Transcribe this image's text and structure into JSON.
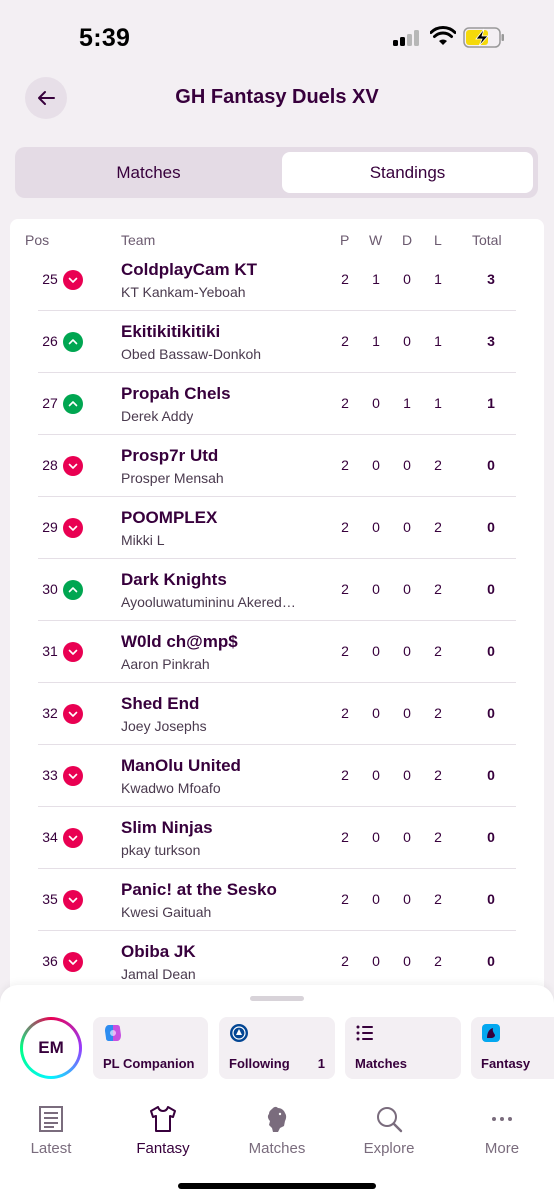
{
  "status": {
    "time": "5:39"
  },
  "header": {
    "title": "GH Fantasy Duels XV"
  },
  "tabs": {
    "matches": "Matches",
    "standings": "Standings"
  },
  "table": {
    "headers": {
      "pos": "Pos",
      "team": "Team",
      "p": "P",
      "w": "W",
      "d": "D",
      "l": "L",
      "total": "Total"
    },
    "rows": [
      {
        "pos": "25",
        "move": "down",
        "team": "ColdplayCam KT",
        "manager": "KT Kankam-Yeboah",
        "p": "2",
        "w": "1",
        "d": "0",
        "l": "1",
        "total": "3"
      },
      {
        "pos": "26",
        "move": "up",
        "team": "Ekitikitikitiki",
        "manager": "Obed Bassaw-Donkoh",
        "p": "2",
        "w": "1",
        "d": "0",
        "l": "1",
        "total": "3"
      },
      {
        "pos": "27",
        "move": "up",
        "team": "Propah Chels",
        "manager": "Derek Addy",
        "p": "2",
        "w": "0",
        "d": "1",
        "l": "1",
        "total": "1"
      },
      {
        "pos": "28",
        "move": "down",
        "team": "Prosp7r Utd",
        "manager": "Prosper Mensah",
        "p": "2",
        "w": "0",
        "d": "0",
        "l": "2",
        "total": "0"
      },
      {
        "pos": "29",
        "move": "down",
        "team": "POOMPLEX",
        "manager": "Mikki L",
        "p": "2",
        "w": "0",
        "d": "0",
        "l": "2",
        "total": "0"
      },
      {
        "pos": "30",
        "move": "up",
        "team": "Dark Knights",
        "manager": "Ayooluwatumininu Akered…",
        "p": "2",
        "w": "0",
        "d": "0",
        "l": "2",
        "total": "0"
      },
      {
        "pos": "31",
        "move": "down",
        "team": "W0ld ch@mp$",
        "manager": "Aaron Pinkrah",
        "p": "2",
        "w": "0",
        "d": "0",
        "l": "2",
        "total": "0"
      },
      {
        "pos": "32",
        "move": "down",
        "team": "Shed End",
        "manager": "Joey Josephs",
        "p": "2",
        "w": "0",
        "d": "0",
        "l": "2",
        "total": "0"
      },
      {
        "pos": "33",
        "move": "down",
        "team": "ManOlu United",
        "manager": "Kwadwo Mfoafo",
        "p": "2",
        "w": "0",
        "d": "0",
        "l": "2",
        "total": "0"
      },
      {
        "pos": "34",
        "move": "down",
        "team": "Slim Ninjas",
        "manager": "pkay turkson",
        "p": "2",
        "w": "0",
        "d": "0",
        "l": "2",
        "total": "0"
      },
      {
        "pos": "35",
        "move": "down",
        "team": "Panic! at the Sesko",
        "manager": "Kwesi Gaituah",
        "p": "2",
        "w": "0",
        "d": "0",
        "l": "2",
        "total": "0"
      },
      {
        "pos": "36",
        "move": "down",
        "team": "Obiba JK",
        "manager": "Jamal Dean",
        "p": "2",
        "w": "0",
        "d": "0",
        "l": "2",
        "total": "0"
      }
    ]
  },
  "sheet": {
    "avatar_initials": "EM",
    "chips": [
      {
        "label": "PL Companion",
        "icon": "copilot-icon"
      },
      {
        "label": "Following",
        "count": "1",
        "icon": "chelsea-crest-icon"
      },
      {
        "label": "Matches",
        "icon": "list-icon"
      },
      {
        "label": "Fantasy",
        "icon": "fantasy-app-icon"
      }
    ]
  },
  "tabbar": {
    "items": [
      {
        "label": "Latest",
        "icon": "news-icon"
      },
      {
        "label": "Fantasy",
        "icon": "shirt-icon",
        "active": true
      },
      {
        "label": "Matches",
        "icon": "lion-icon"
      },
      {
        "label": "Explore",
        "icon": "search-icon"
      },
      {
        "label": "More",
        "icon": "more-dots-icon"
      }
    ]
  },
  "colors": {
    "brand": "#37003c",
    "down": "#e90052",
    "up": "#00a651"
  }
}
